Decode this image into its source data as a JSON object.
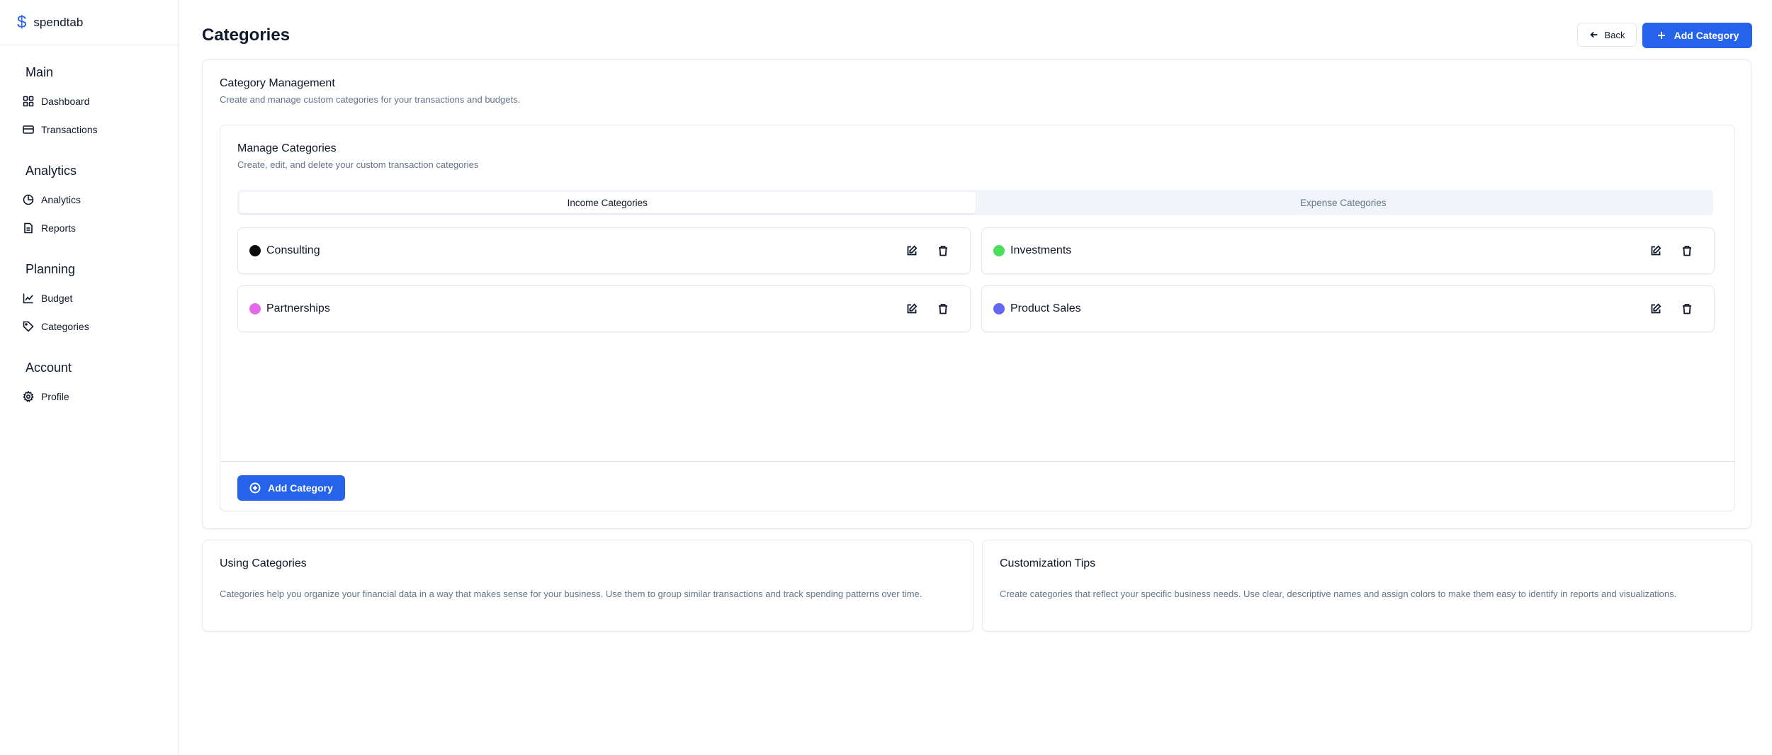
{
  "brand": {
    "name": "spendtab",
    "icon": "dollar-icon"
  },
  "sidebar": {
    "sections": [
      {
        "title": "Main",
        "items": [
          {
            "label": "Dashboard",
            "icon": "dashboard-icon"
          },
          {
            "label": "Transactions",
            "icon": "credit-card-icon"
          }
        ]
      },
      {
        "title": "Analytics",
        "items": [
          {
            "label": "Analytics",
            "icon": "pie-chart-icon"
          },
          {
            "label": "Reports",
            "icon": "file-icon"
          }
        ]
      },
      {
        "title": "Planning",
        "items": [
          {
            "label": "Budget",
            "icon": "line-chart-icon"
          },
          {
            "label": "Categories",
            "icon": "tag-icon"
          }
        ]
      },
      {
        "title": "Account",
        "items": [
          {
            "label": "Profile",
            "icon": "gear-icon"
          }
        ]
      }
    ]
  },
  "header": {
    "title": "Categories",
    "back_label": "Back",
    "add_label": "Add Category"
  },
  "management": {
    "title": "Category Management",
    "description": "Create and manage custom categories for your transactions and budgets."
  },
  "manage": {
    "title": "Manage Categories",
    "description": "Create, edit, and delete your custom transaction categories",
    "tabs": [
      {
        "label": "Income Categories",
        "active": true
      },
      {
        "label": "Expense Categories",
        "active": false
      }
    ],
    "categories": [
      {
        "name": "Consulting",
        "color": "#0a0a0a"
      },
      {
        "name": "Investments",
        "color": "#4ade5a"
      },
      {
        "name": "Partnerships",
        "color": "#e36ae8"
      },
      {
        "name": "Product Sales",
        "color": "#6366f1"
      }
    ],
    "add_label": "Add Category"
  },
  "tips": {
    "using": {
      "title": "Using Categories",
      "text": "Categories help you organize your financial data in a way that makes sense for your business. Use them to group similar transactions and track spending patterns over time."
    },
    "customization": {
      "title": "Customization Tips",
      "text": "Create categories that reflect your specific business needs. Use clear, descriptive names and assign colors to make them easy to identify in reports and visualizations."
    }
  },
  "colors": {
    "accent": "#2563eb",
    "muted_text": "#64748b",
    "border": "#e5e7eb"
  }
}
